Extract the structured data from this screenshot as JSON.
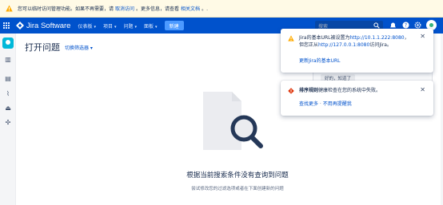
{
  "banner": {
    "text1": "您可以临时访问管理功能。如果不再需要，请",
    "link1": "取消访问",
    "text2": "。更多信息，请查看",
    "link2": "相关文档",
    "text3": "。."
  },
  "topnav": {
    "product": "Jira Software",
    "items": [
      {
        "label": "仪表板"
      },
      {
        "label": "项目"
      },
      {
        "label": "问题"
      },
      {
        "label": "面板"
      }
    ],
    "create_label": "新建",
    "search_placeholder": "搜索"
  },
  "page": {
    "title": "打开问题",
    "switch_filter": "切换筛选器"
  },
  "empty_state": {
    "title": "根据当前搜索条件没有查询到问题",
    "subtitle": "尝试修改您的过滤选项或者在下面创建新的问题"
  },
  "behind_panel": {
    "ok_label": "好的，知道了"
  },
  "flags": {
    "baseurl": {
      "line1_a": "Jira的基本URL被设置为",
      "line1_link": "http://10.1.1.222:8080",
      "line1_b": "，",
      "line2_a": "但您正从",
      "line2_link": "http://127.0.0.1:8080",
      "line2_b": "访问Jira。",
      "action": "更新Jira的基本URL"
    },
    "scheduler": {
      "bold": "排序规则",
      "text": "健康检查在您的系统中失败。",
      "action1": "查找更多",
      "sep": " · ",
      "action2": "不用再提醒我"
    }
  },
  "colors": {
    "brand": "#0052cc",
    "warning": "#ffab00",
    "error": "#de350b"
  }
}
